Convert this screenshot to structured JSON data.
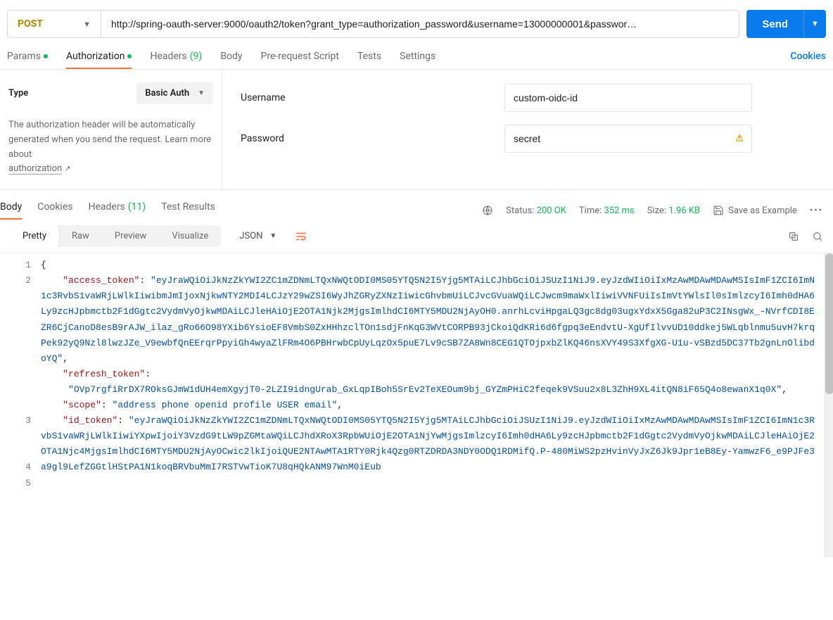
{
  "request": {
    "method": "POST",
    "url": "http://spring-oauth-server:9000/oauth2/token?grant_type=authorization_password&username=13000000001&passwor…",
    "send_label": "Send"
  },
  "req_tabs": {
    "params": "Params",
    "authorization": "Authorization",
    "headers": "Headers",
    "headers_count": "(9)",
    "body": "Body",
    "prereq": "Pre-request Script",
    "tests": "Tests",
    "settings": "Settings",
    "cookies": "Cookies"
  },
  "auth": {
    "type_label": "Type",
    "type_value": "Basic Auth",
    "desc1": "The authorization header will be automatically generated when you send the request. Learn more about ",
    "desc_link": "authorization",
    "username_label": "Username",
    "username_value": "custom-oidc-id",
    "password_label": "Password",
    "password_value": "secret"
  },
  "resp_tabs": {
    "body": "Body",
    "cookies": "Cookies",
    "headers": "Headers",
    "headers_count": "(11)",
    "test_results": "Test Results"
  },
  "resp_meta": {
    "status_label": "Status:",
    "status_value": "200 OK",
    "time_label": "Time:",
    "time_value": "352 ms",
    "size_label": "Size:",
    "size_value": "1.96 KB",
    "save_example": "Save as Example"
  },
  "view": {
    "pretty": "Pretty",
    "raw": "Raw",
    "preview": "Preview",
    "visualize": "Visualize",
    "lang": "JSON"
  },
  "json_body": {
    "keys": {
      "access_token": "\"access_token\"",
      "refresh_token": "\"refresh_token\"",
      "scope": "\"scope\"",
      "id_token": "\"id_token\""
    },
    "access_token": "\"eyJraWQiOiJkNzZkYWI2ZC1mZDNmLTQxNWQtODI0MS05YTQ5N2I5Yjg5MTAiLCJhbGciOiJSUzI1NiJ9.eyJzdWIiOiIxMzAwMDAwMDAwMSIsImF1ZCI6ImN1c3RvbS1vaWRjLWlkIiwibmJmIjoxNjkwNTY2MDI4LCJzY29wZSI6WyJhZGRyZXNzIiwicGhvbmUiLCJvcGVuaWQiLCJwcm9maWxlIiwiVVNFUiIsImVtYWlsIl0sImlzcyI6Imh0dHA6Ly9zcHJpbmctb2F1dGgtc2VydmVyOjkwMDAiLCJleHAiOjE2OTA1Njk2MjgsImlhdCI6MTY5MDU2NjAyOH0.anrhLcviHpgaLQ3gc8dg03ugxYdxX5Gga82uP3C2INsgWx_-NVrfCDI8EZR6CjCanoD8esB9rAJW_ilaz_gRo66O98YXib6YsioEF8VmbS0ZxHHhzclTOn1sdjFnKqG3WVtCORPB93jCkoiQdKRi6d6fgpq3eEndvtU-XgUfIlvvUD10ddkej5WLqblnmu5uvH7krqPek92yQ9Nzl8lwzJZe_V9ewbfQnEErqrPpyiGh4wyaZlFRm4O6PBHrwbCpUyLqzOx5puE7Lv9cSB7ZA8Wn8CEG1QTOjpxbZlKQ46nsXVY49S3XfgXG-U1u-vSBzd5DC37Tb2gnLnOlibdoYQ\"",
    "refresh_token": "\"OVp7rgfiRrDX7ROksGJmW1dUH4emXgyjT0-2LZI9idngUrab_GxLqpIBoh5SrEv2TeXEOum9bj_GYZmPHiC2feqek9VSuu2x8L3ZhH9XL4itQN8iF65Q4o8ewanX1q0X\"",
    "scope": "\"address phone openid profile USER email\"",
    "id_token": "\"eyJraWQiOiJkNzZkYWI2ZC1mZDNmLTQxNWQtODI0MS05YTQ5N2I5Yjg5MTAiLCJhbGciOiJSUzI1NiJ9.eyJzdWIiOiIxMzAwMDAwMDAwMSIsImF1ZCI6ImN1c3RvbS1vaWRjLWlkIiwiYXpwIjoiY3VzdG9tLW9pZGMtaWQiLCJhdXRoX3RpbWUiOjE2OTA1NjYwMjgsImlzcyI6Imh0dHA6Ly9zcHJpbmctb2F1dGgtc2VydmVyOjkwMDAiLCJleHAiOjE2OTA1Njc4MjgsImlhdCI6MTY5MDU2NjAyOCwic2lkIjoiQUE2NTAwMTA1RTY0Rjk4Qzg0RTZDRDA3NDY0ODQ1RDMifQ.P-480MiWS2pzHvinVyJxZ6Jk9Jpr1eB8Ey-YamwzF6_e9PJFe3a9gl9LefZGGtlHStPA1N1koqBRVbuMmI7RSTVwTioK7U8qHQkANM97WnM0iEub"
  }
}
